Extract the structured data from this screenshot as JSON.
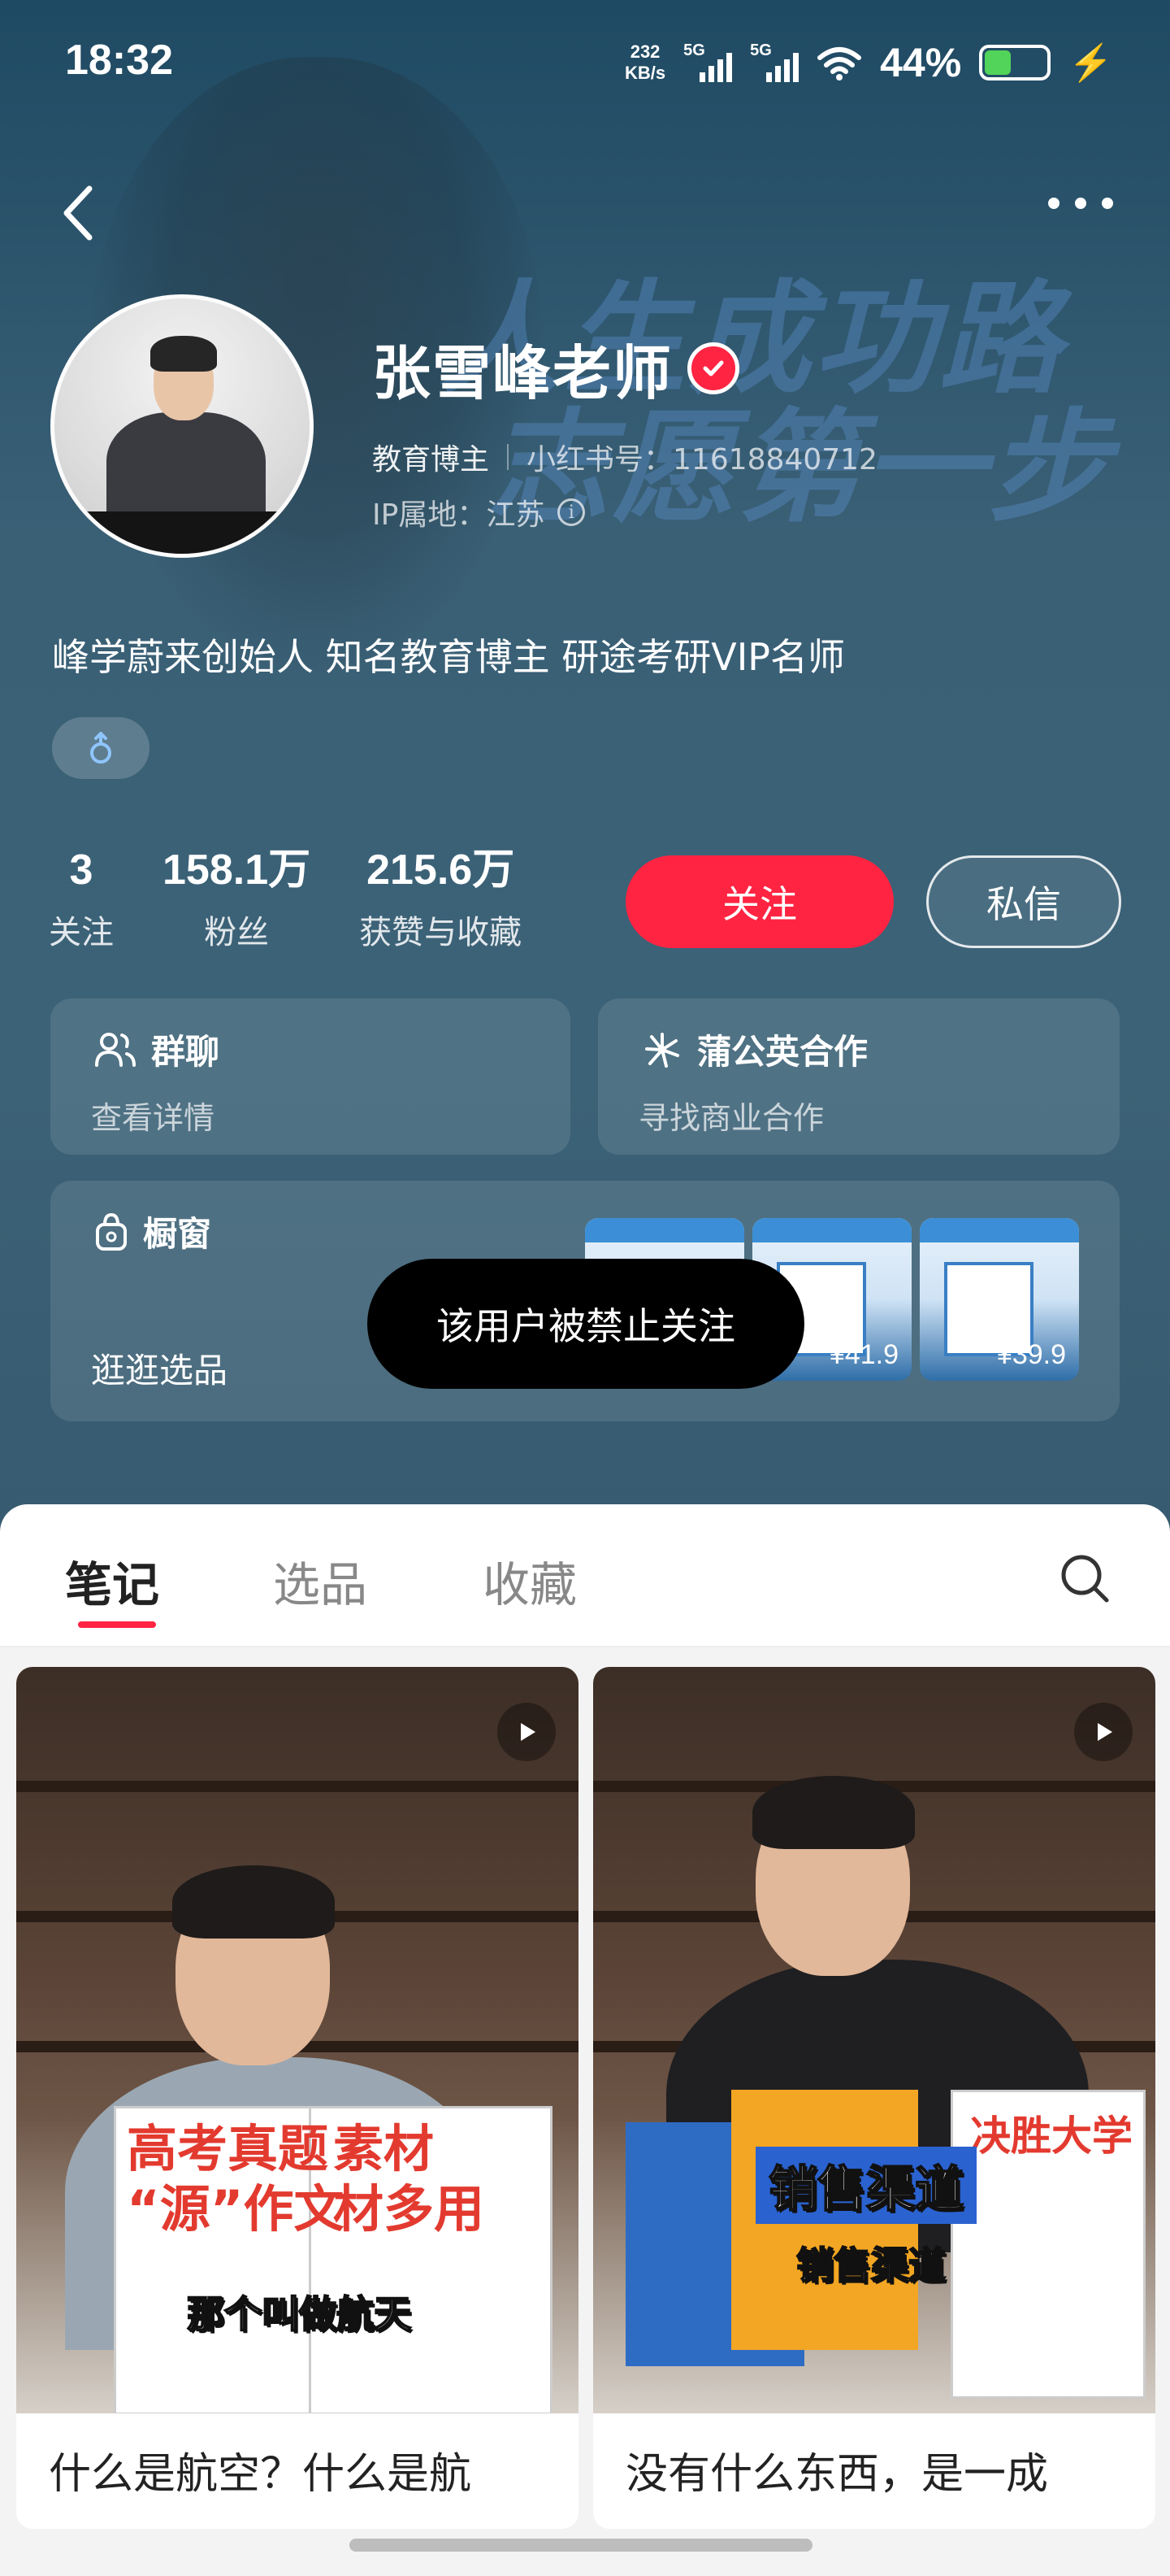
{
  "status_bar": {
    "time": "18:32",
    "net_speed_value": "232",
    "net_speed_unit": "KB/s",
    "signal_1_label": "5G",
    "signal_2_label": "5G",
    "battery_percent": "44%",
    "battery_level": 0.44,
    "icons": [
      "wifi-icon",
      "battery-icon",
      "charging-icon"
    ]
  },
  "nav": {
    "back_icon": "chevron-left-icon",
    "more_icon": "more-dots-icon"
  },
  "banner": {
    "slogan_line1": "人生成功路",
    "slogan_line2": "志愿第一步"
  },
  "profile": {
    "name": "张雪峰老师",
    "verified_icon": "verified-check-icon",
    "tag": "教育博主",
    "red_id": "小红书号：11618840712",
    "ip": "IP属地：江苏",
    "bio": "峰学蔚来创始人 知名教育博主 研途考研VIP名师",
    "gender_icon": "male-icon"
  },
  "stats": [
    {
      "value": "3",
      "label": "关注"
    },
    {
      "value": "158.1万",
      "label": "粉丝"
    },
    {
      "value": "215.6万",
      "label": "获赞与收藏"
    }
  ],
  "actions": {
    "follow_label": "关注",
    "message_label": "私信",
    "follow_color": "#ff2442"
  },
  "cards": {
    "group": {
      "title": "群聊",
      "subtitle": "查看详情",
      "icon": "group-users-icon"
    },
    "dandelion": {
      "title": "蒲公英合作",
      "subtitle": "寻找商业合作",
      "icon": "dandelion-icon"
    },
    "shop": {
      "title": "橱窗",
      "subtitle": "逛逛选品",
      "icon": "shopping-bag-icon",
      "products": [
        {
          "price": ""
        },
        {
          "price": "¥41.9"
        },
        {
          "price": "¥39.9"
        }
      ]
    }
  },
  "toast": {
    "message": "该用户被禁止关注"
  },
  "tabs": {
    "items": [
      "笔记",
      "选品",
      "收藏"
    ],
    "active_index": 0,
    "search_icon": "search-icon"
  },
  "notes": [
    {
      "title": "什么是航空？什么是航",
      "cover_book_title_line1": "高考真题",
      "cover_book_title_line2": "“源”作文",
      "cover_book_title_right": "素材",
      "cover_book_title_right2": "材多用",
      "cover_caption": "那个叫做航天",
      "type_icon": "play-icon"
    },
    {
      "title": "没有什么东西，是一成",
      "cover_book_title": "决胜大学",
      "cover_caption": "销售渠道",
      "cover_caption_top": "销售渠道",
      "type_icon": "play-icon"
    }
  ]
}
